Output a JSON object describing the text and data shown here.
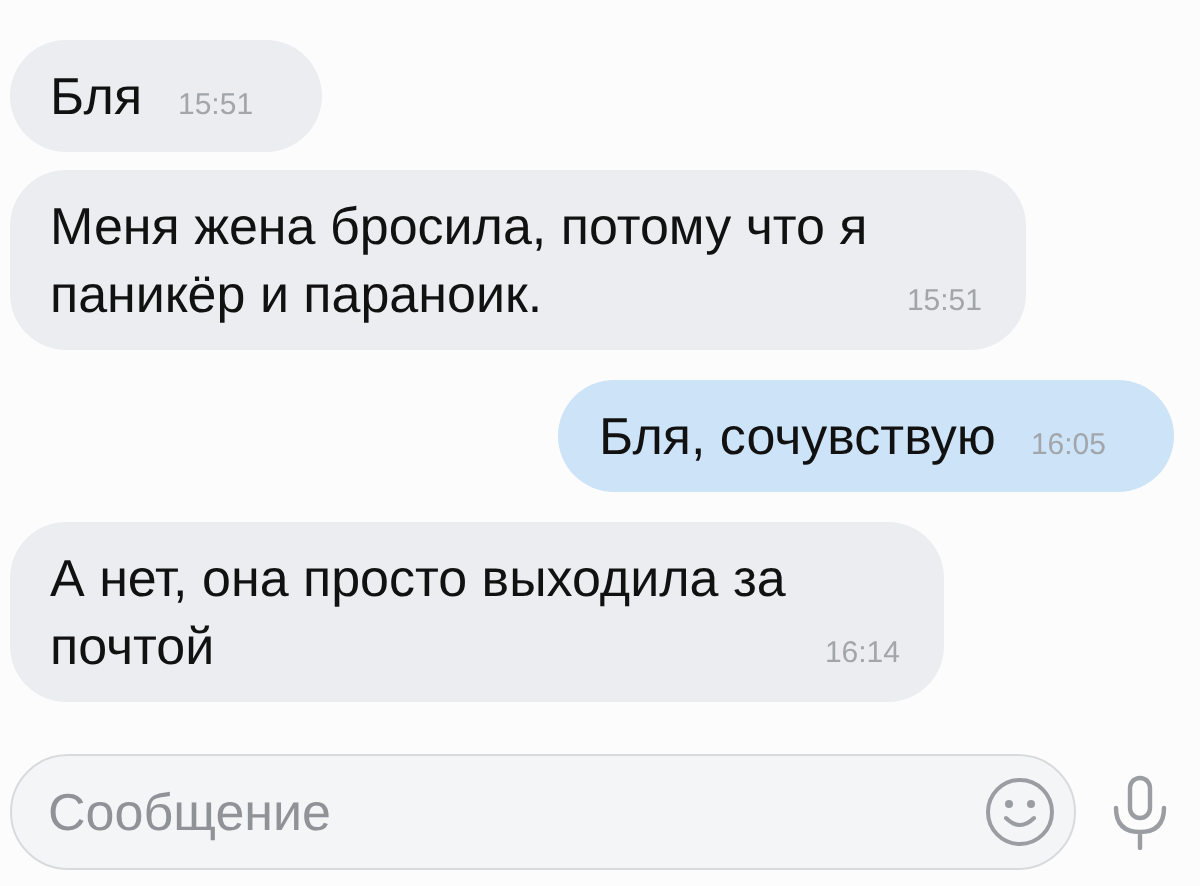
{
  "messages": [
    {
      "kind": "incoming",
      "text": "Бля",
      "time": "15:51"
    },
    {
      "kind": "incoming",
      "text": "Меня жена бросила, потому что я паникёр и параноик.",
      "time": "15:51"
    },
    {
      "kind": "outgoing",
      "text": "Бля, сочувствую",
      "time": "16:05"
    },
    {
      "kind": "incoming",
      "text": "А нет, она просто выходила за почтой",
      "time": "16:14"
    }
  ],
  "composer": {
    "placeholder": "Сообщение"
  }
}
